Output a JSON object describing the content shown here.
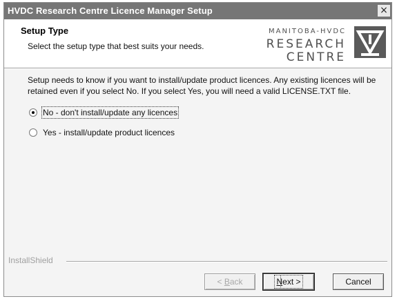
{
  "window": {
    "title": "HVDC Research Centre Licence Manager Setup",
    "close_glyph": "×"
  },
  "header": {
    "title": "Setup Type",
    "subtitle": "Select the setup type that best suits your needs.",
    "logo": {
      "line1": "MANITOBA-HVDC",
      "line2": "RESEARCH",
      "line3": "CENTRE",
      "icon": "hvdc-triangle-logo-icon"
    }
  },
  "body": {
    "description": "Setup needs to know if you want to install/update product licences. Any existing licences will be retained even if you select No. If you select Yes, you will need a valid LICENSE.TXT file.",
    "options": [
      {
        "label": "No - don't install/update any licences",
        "checked": true
      },
      {
        "label": "Yes - install/update product licences",
        "checked": false
      }
    ]
  },
  "footer": {
    "brand": "InstallShield",
    "buttons": {
      "back": {
        "prefix": "< ",
        "mnemonic": "B",
        "rest": "ack",
        "enabled": false
      },
      "next": {
        "mnemonic": "N",
        "rest": "ext >",
        "enabled": true
      },
      "cancel": {
        "label": "Cancel",
        "enabled": true
      }
    }
  },
  "colors": {
    "titlebar": "#767676",
    "dialog_bg": "#f4f4f4",
    "header_bg": "#ffffff",
    "logo": "#5a5a5a"
  }
}
